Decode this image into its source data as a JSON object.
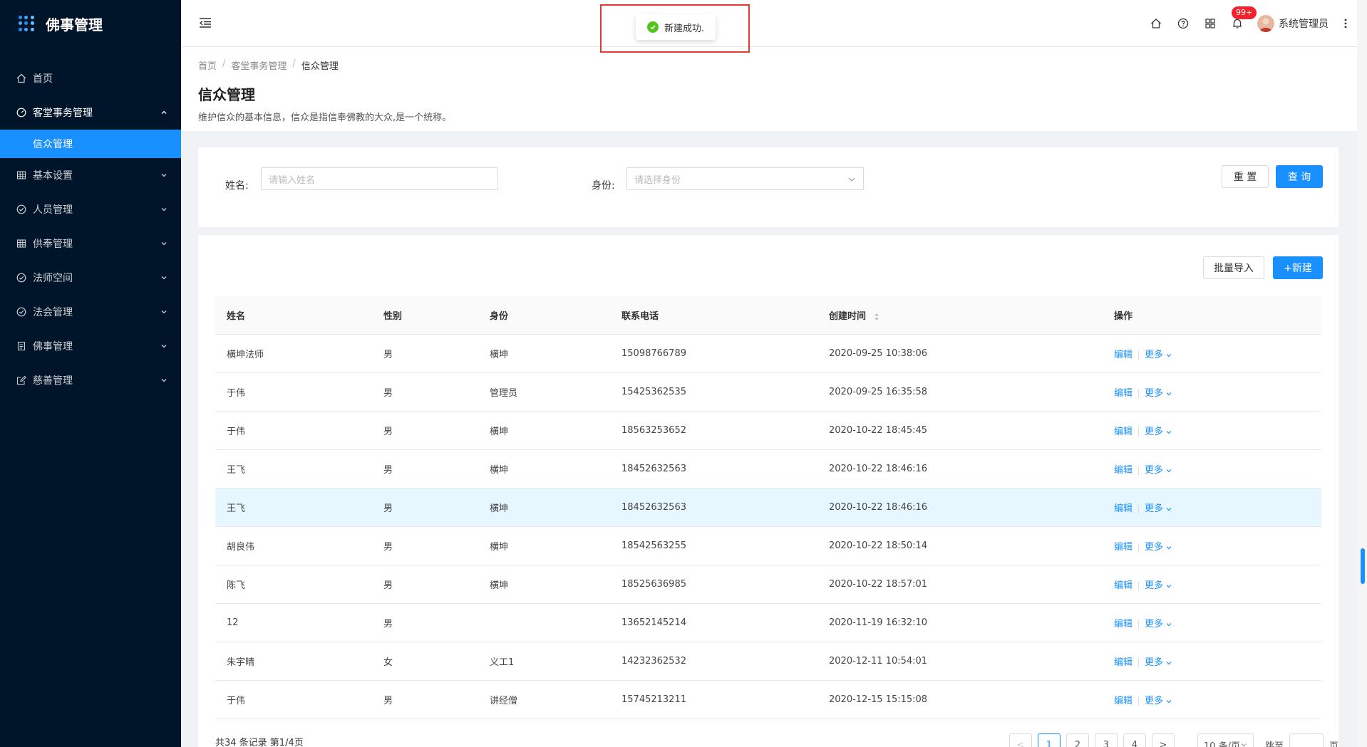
{
  "app": {
    "title": "佛事管理"
  },
  "sidebar": {
    "items": [
      {
        "label": "首页",
        "icon": "home-icon"
      },
      {
        "label": "客堂事务管理",
        "icon": "dashboard-icon",
        "open": true,
        "children": [
          {
            "label": "信众管理",
            "active": true
          }
        ]
      },
      {
        "label": "基本设置",
        "icon": "table-icon"
      },
      {
        "label": "人员管理",
        "icon": "check-circle-icon"
      },
      {
        "label": "供奉管理",
        "icon": "table-icon"
      },
      {
        "label": "法师空间",
        "icon": "check-circle-icon"
      },
      {
        "label": "法会管理",
        "icon": "check-circle-icon"
      },
      {
        "label": "佛事管理",
        "icon": "file-icon"
      },
      {
        "label": "慈善管理",
        "icon": "edit-icon"
      }
    ]
  },
  "header": {
    "badge": "99+",
    "username": "系统管理员"
  },
  "toast": {
    "message": "新建成功."
  },
  "breadcrumb": [
    "首页",
    "客堂事务管理",
    "信众管理"
  ],
  "page": {
    "title": "信众管理",
    "description": "维护信众的基本信息，信众是指信奉佛教的大众,是一个统称。"
  },
  "search": {
    "name_label": "姓名:",
    "name_placeholder": "请输入姓名",
    "identity_label": "身份:",
    "identity_placeholder": "请选择身份",
    "reset_label": "重 置",
    "query_label": "查 询"
  },
  "toolbar": {
    "import_label": "批量导入",
    "new_label": "+新建"
  },
  "table": {
    "columns": [
      "姓名",
      "性别",
      "身份",
      "联系电话",
      "创建时间",
      "操作"
    ],
    "edit_label": "编辑",
    "more_label": "更多",
    "rows": [
      [
        "横坤法师",
        "男",
        "横坤",
        "15098766789",
        "2020-09-25 10:38:06"
      ],
      [
        "于伟",
        "男",
        "管理员",
        "15425362535",
        "2020-09-25 16:35:58"
      ],
      [
        "于伟",
        "男",
        "横坤",
        "18563253652",
        "2020-10-22 18:45:45"
      ],
      [
        "王飞",
        "男",
        "横坤",
        "18452632563",
        "2020-10-22 18:46:16"
      ],
      [
        "王飞",
        "男",
        "横坤",
        "18452632563",
        "2020-10-22 18:46:16"
      ],
      [
        "胡良伟",
        "男",
        "横坤",
        "18542563255",
        "2020-10-22 18:50:14"
      ],
      [
        "陈飞",
        "男",
        "横坤",
        "18525636985",
        "2020-10-22 18:57:01"
      ],
      [
        "12",
        "男",
        "",
        "13652145214",
        "2020-11-19 16:32:10"
      ],
      [
        "朱宇晴",
        "女",
        "义工1",
        "14232362532",
        "2020-12-11 10:54:01"
      ],
      [
        "于伟",
        "男",
        "讲经僧",
        "15745213211",
        "2020-12-15 15:15:08"
      ]
    ]
  },
  "pagination": {
    "summary": "共34 条记录 第1/4页",
    "prev": "<",
    "next": ">",
    "pages": [
      "1",
      "2",
      "3",
      "4"
    ],
    "page_size": "10 条/页",
    "jump_label": "跳至",
    "jump_unit": "页"
  },
  "colors": {
    "primary": "#1890ff",
    "sidebar_bg": "#001529",
    "success": "#52c41a",
    "danger": "#f5222d"
  }
}
